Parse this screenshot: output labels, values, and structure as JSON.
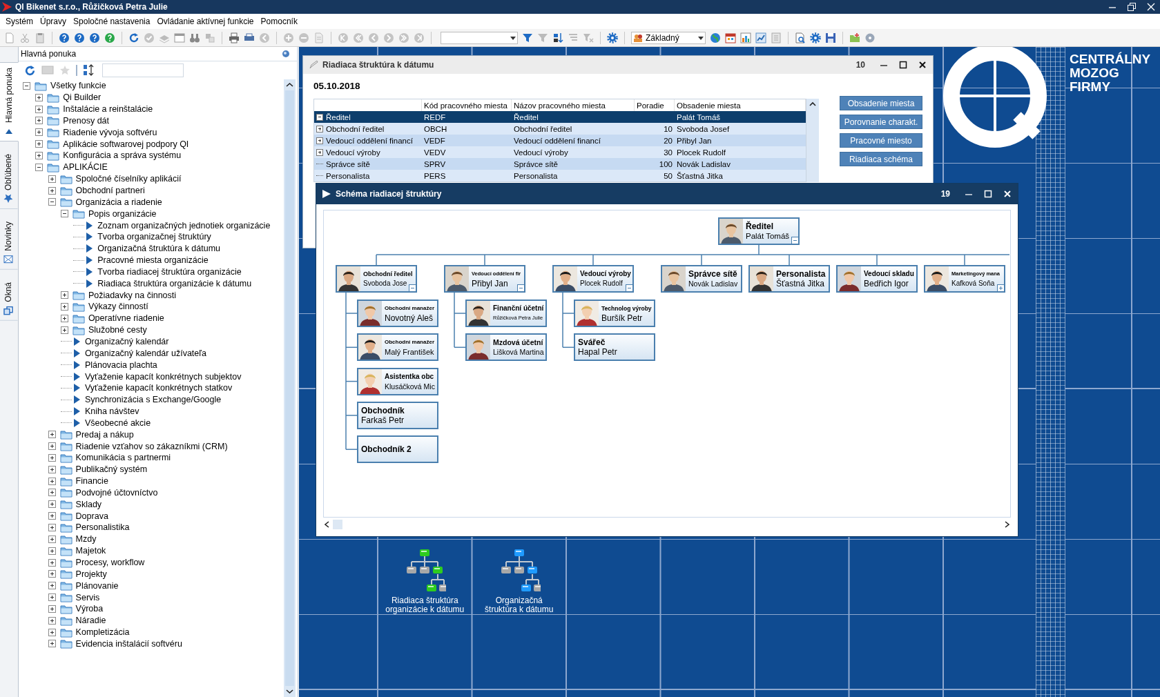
{
  "window": {
    "title": "QI Bikenet s.r.o., Růžičková Petra Julie"
  },
  "menu": [
    "Systém",
    "Úpravy",
    "Spoločné nastavenia",
    "Ovládanie aktívnej funkcie",
    "Pomocník"
  ],
  "toolbar": {
    "view_select": "Základný"
  },
  "side_tabs": [
    {
      "label": "Hlavná ponuka",
      "selected": true
    },
    {
      "label": "Obľúbené",
      "selected": false
    },
    {
      "label": "Novinky",
      "selected": false
    },
    {
      "label": "Okná",
      "selected": false
    }
  ],
  "panel": {
    "title": "Hlavná ponuka",
    "tree": [
      {
        "label": "Všetky funkcie",
        "kind": "folder",
        "expanded": true,
        "children": [
          {
            "label": "Qi Builder",
            "kind": "folder",
            "expanded": false
          },
          {
            "label": "Inštalácie a reinštalácie",
            "kind": "folder",
            "expanded": false
          },
          {
            "label": "Prenosy dát",
            "kind": "folder",
            "expanded": false
          },
          {
            "label": "Riadenie vývoja softvéru",
            "kind": "folder",
            "expanded": false
          },
          {
            "label": "Aplikácie softwarovej podpory QI",
            "kind": "folder",
            "expanded": false
          },
          {
            "label": "Konfigurácia a správa systému",
            "kind": "folder",
            "expanded": false
          },
          {
            "label": "APLIKÁCIE",
            "kind": "folder",
            "expanded": true,
            "children": [
              {
                "label": "Spoločné číselníky aplikácií",
                "kind": "folder",
                "expanded": false
              },
              {
                "label": "Obchodní partneri",
                "kind": "folder",
                "expanded": false
              },
              {
                "label": "Organizácia a riadenie",
                "kind": "folder",
                "expanded": true,
                "children": [
                  {
                    "label": "Popis organizácie",
                    "kind": "folder",
                    "expanded": true,
                    "children": [
                      {
                        "label": "Zoznam organizačných jednotiek organizácie",
                        "kind": "function"
                      },
                      {
                        "label": "Tvorba organizačnej štruktúry",
                        "kind": "function"
                      },
                      {
                        "label": "Organizačná štruktúra k dátumu",
                        "kind": "function"
                      },
                      {
                        "label": "Pracovné miesta organizácie",
                        "kind": "function"
                      },
                      {
                        "label": "Tvorba riadiacej štruktúra organizácie",
                        "kind": "function"
                      },
                      {
                        "label": "Riadiaca štruktúra organizácie k dátumu",
                        "kind": "function"
                      }
                    ]
                  },
                  {
                    "label": "Požiadavky na činnosti",
                    "kind": "folder",
                    "expanded": false
                  },
                  {
                    "label": "Výkazy činností",
                    "kind": "folder",
                    "expanded": false
                  },
                  {
                    "label": "Operatívne riadenie",
                    "kind": "folder",
                    "expanded": false
                  },
                  {
                    "label": "Služobné cesty",
                    "kind": "folder",
                    "expanded": false
                  },
                  {
                    "label": "Organizačný kalendár",
                    "kind": "function"
                  },
                  {
                    "label": "Organizačný kalendár užívateľa",
                    "kind": "function"
                  },
                  {
                    "label": "Plánovacia plachta",
                    "kind": "function"
                  },
                  {
                    "label": "Vyťaženie kapacít konkrétnych subjektov",
                    "kind": "function"
                  },
                  {
                    "label": "Vyťaženie kapacít konkrétnych statkov",
                    "kind": "function"
                  },
                  {
                    "label": "Synchronizácia s Exchange/Google",
                    "kind": "function"
                  },
                  {
                    "label": "Kniha návštev",
                    "kind": "function"
                  },
                  {
                    "label": "Všeobecné akcie",
                    "kind": "function"
                  }
                ]
              },
              {
                "label": "Predaj a nákup",
                "kind": "folder",
                "expanded": false
              },
              {
                "label": "Riadenie vzťahov so zákazníkmi (CRM)",
                "kind": "folder",
                "expanded": false
              },
              {
                "label": "Komunikácia s partnermi",
                "kind": "folder",
                "expanded": false
              },
              {
                "label": "Publikačný systém",
                "kind": "folder",
                "expanded": false
              },
              {
                "label": "Financie",
                "kind": "folder",
                "expanded": false
              },
              {
                "label": "Podvojné účtovníctvo",
                "kind": "folder",
                "expanded": false
              },
              {
                "label": "Sklady",
                "kind": "folder",
                "expanded": false
              },
              {
                "label": "Doprava",
                "kind": "folder",
                "expanded": false
              },
              {
                "label": "Personalistika",
                "kind": "folder",
                "expanded": false
              },
              {
                "label": "Mzdy",
                "kind": "folder",
                "expanded": false
              },
              {
                "label": "Majetok",
                "kind": "folder",
                "expanded": false
              },
              {
                "label": "Procesy, workflow",
                "kind": "folder",
                "expanded": false
              },
              {
                "label": "Projekty",
                "kind": "folder",
                "expanded": false
              },
              {
                "label": "Plánovanie",
                "kind": "folder",
                "expanded": false
              },
              {
                "label": "Servis",
                "kind": "folder",
                "expanded": false
              },
              {
                "label": "Výroba",
                "kind": "folder",
                "expanded": false
              },
              {
                "label": "Náradie",
                "kind": "folder",
                "expanded": false
              },
              {
                "label": "Kompletizácia",
                "kind": "folder",
                "expanded": false
              },
              {
                "label": "Evidencia inštalácií softvéru",
                "kind": "folder",
                "expanded": false
              }
            ]
          }
        ]
      }
    ]
  },
  "logo": {
    "text": "CENTRÁLNY\nMOZOG\nFIRMY"
  },
  "date_window": {
    "title": "Riadiaca štruktúra k dátumu",
    "count": "10",
    "date": "05.10.2018",
    "columns": [
      "Kód pracovného miesta",
      "Názov pracovného miesta",
      "Poradie",
      "Obsadenie miesta"
    ],
    "rows": [
      {
        "name": "Ředitel",
        "kind": "group",
        "expanded": true,
        "code": "REDF",
        "title": "Ředitel",
        "holder": "Palát Tomáš",
        "selected": true
      },
      {
        "name": "Obchodní ředitel",
        "kind": "group",
        "expanded": false,
        "code": "OBCH",
        "title": "Obchodní ředitel",
        "order": "10",
        "holder": "Svoboda Josef",
        "selected": false
      },
      {
        "name": "Vedoucí oddělení financí",
        "kind": "group",
        "expanded": false,
        "code": "VEDF",
        "title": "Vedoucí oddělení financí",
        "order": "20",
        "holder": "Přibyl Jan",
        "selected": false
      },
      {
        "name": "Vedoucí výroby",
        "kind": "group",
        "expanded": false,
        "code": "VEDV",
        "title": "Vedoucí výroby",
        "order": "30",
        "holder": "Plocek Rudolf",
        "selected": false
      },
      {
        "name": "Správce sítě",
        "kind": "leaf",
        "code": "SPRV",
        "title": "Správce sítě",
        "order": "100",
        "holder": "Novák Ladislav",
        "selected": false
      },
      {
        "name": "Personalista",
        "kind": "leaf",
        "code": "PERS",
        "title": "Personalista",
        "order": "50",
        "holder": "Šťastná Jitka",
        "selected": false
      }
    ],
    "buttons": [
      "Obsadenie miesta",
      "Porovnanie charakt.",
      "Pracovné miesto",
      "Riadiaca schéma"
    ]
  },
  "schema_window": {
    "title": "Schéma riadiacej štruktúry",
    "count": "19",
    "root": {
      "title": "Ředitel",
      "name": "Palát Tomáš",
      "photo": true,
      "expanded": true,
      "children": [
        {
          "title": "Obchodní ředitel",
          "name": "Svoboda Jose",
          "photo": true,
          "expanded": true,
          "children": [
            {
              "title": "Obchodní manažer",
              "name": "Novotný Aleš",
              "photo": true
            },
            {
              "title": "Obchodní manažer",
              "name": "Malý František",
              "photo": true
            },
            {
              "title": "Asistentka obc",
              "name": "Klusáčková Mic",
              "photo": true
            },
            {
              "title": "Obchodník",
              "name": "Farkaš Petr",
              "photo": false
            },
            {
              "title": "Obchodník 2",
              "photo": false
            }
          ]
        },
        {
          "title": "Vedoucí oddělení fir",
          "name": "Přibyl Jan",
          "photo": true,
          "expanded": true,
          "children": [
            {
              "title": "Finanční účetní",
              "name": "Růžičková Petra Julie",
              "photo": true
            },
            {
              "title": "Mzdová účetní",
              "name": "Lišková Martina",
              "photo": true
            }
          ]
        },
        {
          "title": "Vedoucí výroby",
          "name": "Plocek Rudolf",
          "photo": true,
          "expanded": true,
          "children": [
            {
              "title": "Technolog výroby",
              "name": "Buršík Petr",
              "photo": true
            },
            {
              "title": "Svářeč",
              "name": "Hapal Petr",
              "photo": false
            }
          ]
        },
        {
          "title": "Správce sítě",
          "name": "Novák Ladislav",
          "photo": true
        },
        {
          "title": "Personalista",
          "name": "Šťastná Jitka",
          "photo": true
        },
        {
          "title": "Vedoucí skladu",
          "name": "Bedřich Igor",
          "photo": true
        },
        {
          "title": "Marketingový mana",
          "name": "Kafková Soňa",
          "photo": true,
          "expanded": false
        }
      ]
    }
  },
  "desktop_shortcuts": [
    {
      "label": "Riadiaca štruktúra\norganizácie k dátumu",
      "color": "#2ecc1f"
    },
    {
      "label": "Organizačná\nštruktúra k dátumu",
      "color": "#1f9bff"
    }
  ]
}
